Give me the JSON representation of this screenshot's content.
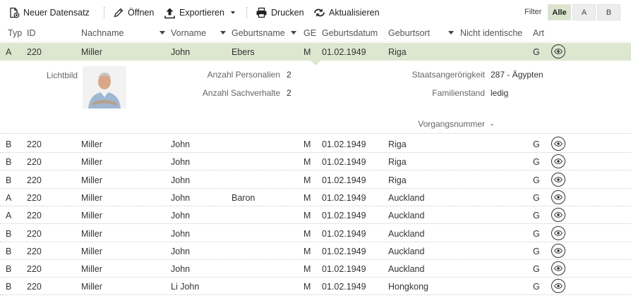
{
  "toolbar": {
    "new_record": "Neuer Datensatz",
    "open": "Öffnen",
    "export": "Exportieren",
    "print": "Drucken",
    "refresh": "Aktualisieren",
    "filter_label": "Filter",
    "filter_options": [
      "Alle",
      "A",
      "B"
    ],
    "filter_selected": "Alle"
  },
  "columns": {
    "typ": "Typ",
    "id": "ID",
    "nachname": "Nachname",
    "vorname": "Vorname",
    "geburtsname": "Geburtsname",
    "ge": "GE",
    "geburtsdatum": "Geburtsdatum",
    "geburtsort": "Geburtsort",
    "nicht_identische": "Nicht identische",
    "art": "Art"
  },
  "selected_row": {
    "typ": "A",
    "id": "220",
    "nachname": "Miller",
    "vorname": "John",
    "geburtsname": "Ebers",
    "ge": "M",
    "geburtsdatum": "01.02.1949",
    "geburtsort": "Riga",
    "art": "G"
  },
  "detail": {
    "photo_label": "Lichtbild",
    "anzahl_personalien_label": "Anzahl Personalien",
    "anzahl_personalien": "2",
    "anzahl_sachverhalte_label": "Anzahl Sachverhalte",
    "anzahl_sachverhalte": "2",
    "staatsangehoerigkeit_label": "Staatsangerörigkeit",
    "staatsangehoerigkeit": "287 - Ägypten",
    "familienstand_label": "Familienstand",
    "familienstand": "ledig",
    "vorgangsnummer_label": "Vorgangsnummer",
    "vorgangsnummer": "-"
  },
  "rows": [
    {
      "typ": "B",
      "id": "220",
      "nachname": "Miller",
      "vorname": "John",
      "geburtsname": "",
      "ge": "M",
      "geburtsdatum": "01.02.1949",
      "geburtsort": "Riga",
      "art": "G"
    },
    {
      "typ": "B",
      "id": "220",
      "nachname": "Miller",
      "vorname": "John",
      "geburtsname": "",
      "ge": "M",
      "geburtsdatum": "01.02.1949",
      "geburtsort": "Riga",
      "art": "G"
    },
    {
      "typ": "B",
      "id": "220",
      "nachname": "Miller",
      "vorname": "John",
      "geburtsname": "",
      "ge": "M",
      "geburtsdatum": "01.02.1949",
      "geburtsort": "Riga",
      "art": "G"
    },
    {
      "typ": "A",
      "id": "220",
      "nachname": "Miller",
      "vorname": "John",
      "geburtsname": "Baron",
      "ge": "M",
      "geburtsdatum": "01.02.1949",
      "geburtsort": "Auckland",
      "art": "G"
    },
    {
      "typ": "A",
      "id": "220",
      "nachname": "Miller",
      "vorname": "John",
      "geburtsname": "",
      "ge": "M",
      "geburtsdatum": "01.02.1949",
      "geburtsort": "Auckland",
      "art": "G"
    },
    {
      "typ": "B",
      "id": "220",
      "nachname": "Miller",
      "vorname": "John",
      "geburtsname": "",
      "ge": "M",
      "geburtsdatum": "01.02.1949",
      "geburtsort": "Auckland",
      "art": "G"
    },
    {
      "typ": "B",
      "id": "220",
      "nachname": "Miller",
      "vorname": "John",
      "geburtsname": "",
      "ge": "M",
      "geburtsdatum": "01.02.1949",
      "geburtsort": "Auckland",
      "art": "G"
    },
    {
      "typ": "B",
      "id": "220",
      "nachname": "Miller",
      "vorname": "John",
      "geburtsname": "",
      "ge": "M",
      "geburtsdatum": "01.02.1949",
      "geburtsort": "Auckland",
      "art": "G"
    },
    {
      "typ": "B",
      "id": "220",
      "nachname": "Miller",
      "vorname": "Li John",
      "geburtsname": "",
      "ge": "M",
      "geburtsdatum": "01.02.1949",
      "geburtsort": "Hongkong",
      "art": "G"
    }
  ]
}
